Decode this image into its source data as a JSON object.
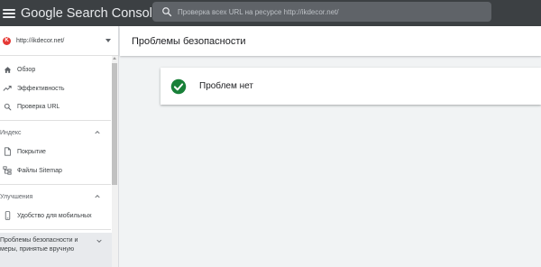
{
  "header": {
    "brand_google": "Google",
    "brand_product": "Search Console",
    "search_placeholder": "Проверка всех URL на ресурсе http://ikdecor.net/"
  },
  "sidebar": {
    "property": {
      "url": "http://ikdecor.net/"
    },
    "items": [
      {
        "label": "Обзор",
        "icon": "home-icon"
      },
      {
        "label": "Эффективность",
        "icon": "trend-icon"
      },
      {
        "label": "Проверка URL",
        "icon": "search-icon"
      }
    ],
    "sections": [
      {
        "label": "Индекс",
        "items": [
          {
            "label": "Покрытие",
            "icon": "document-icon"
          },
          {
            "label": "Файлы Sitemap",
            "icon": "sitemap-icon"
          }
        ]
      },
      {
        "label": "Улучшения",
        "items": [
          {
            "label": "Удобство для мобильных",
            "icon": "mobile-icon"
          }
        ]
      },
      {
        "label": "Проблемы безопасности и меры, принятые вручную",
        "items": []
      }
    ]
  },
  "main": {
    "title": "Проблемы безопасности",
    "status_text": "Проблем нет"
  },
  "colors": {
    "header_bg": "#3c4043",
    "search_bg": "#5f6368",
    "success_green": "#188038",
    "favicon_red": "#e53935",
    "active_section_bg": "#e8eaed"
  }
}
